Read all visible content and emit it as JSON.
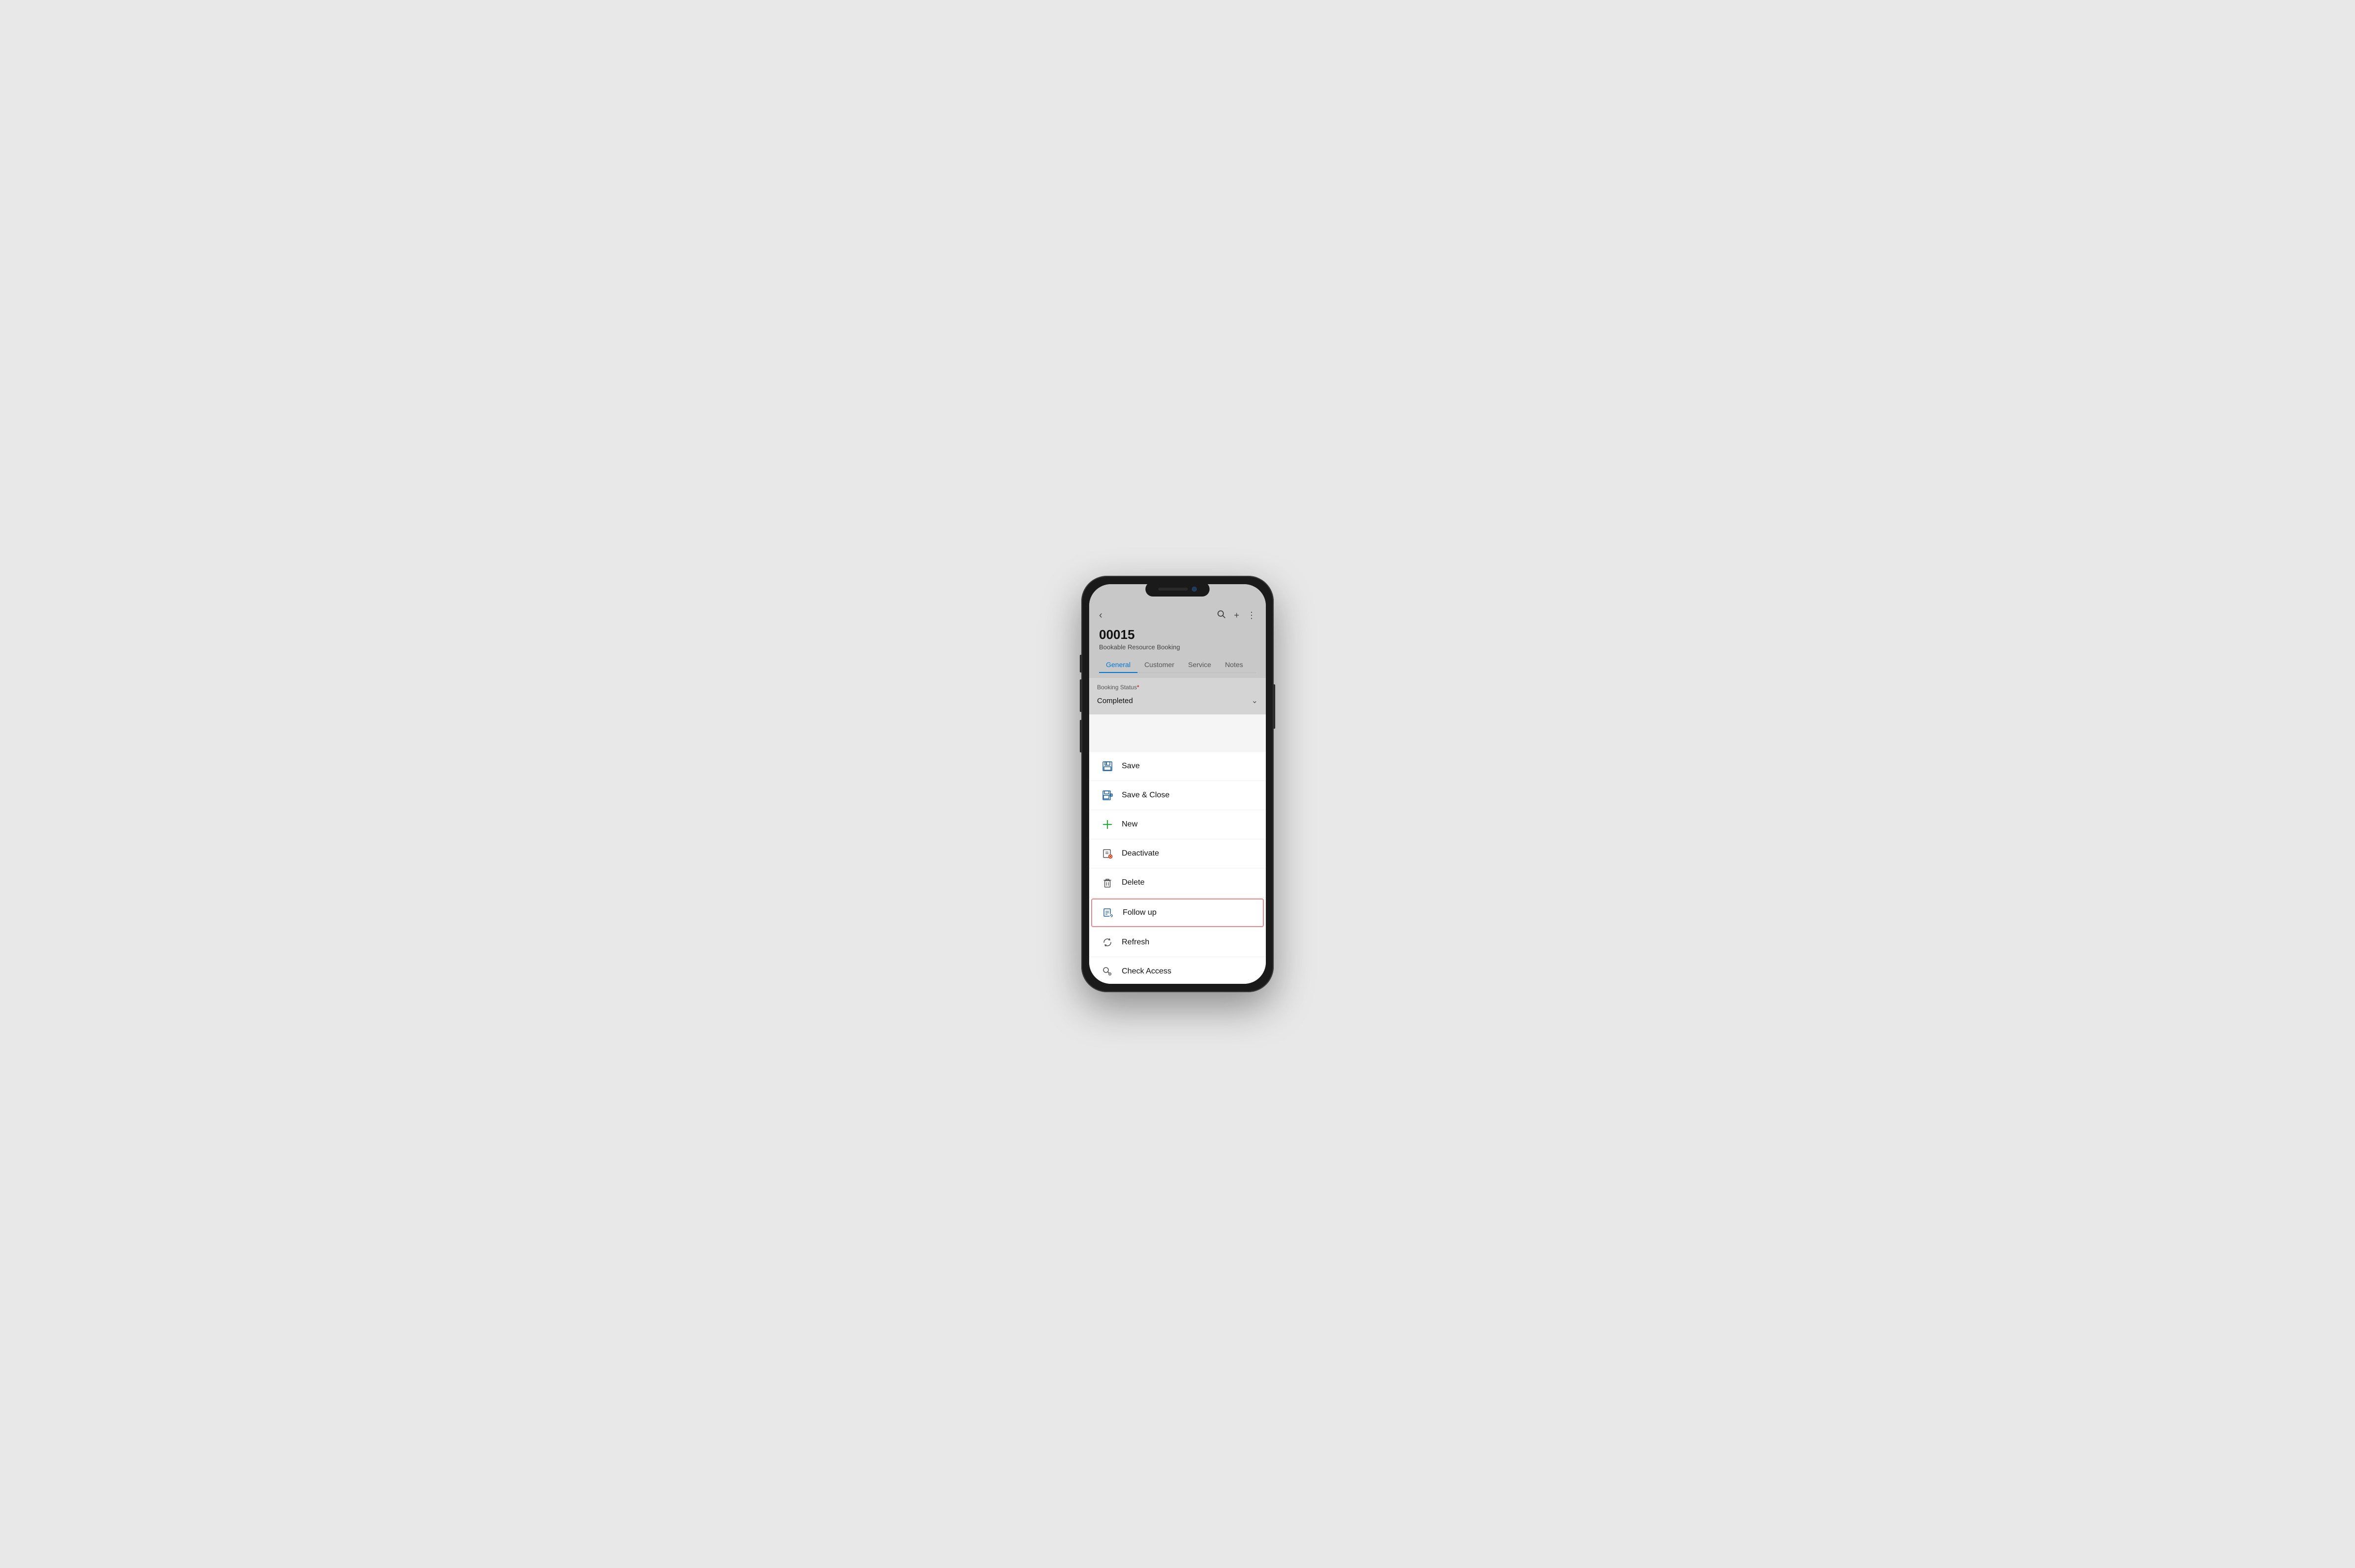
{
  "phone": {
    "header": {
      "record_id": "00015",
      "record_subtitle": "Bookable Resource Booking",
      "back_icon": "‹",
      "search_icon": "⌕",
      "add_icon": "+",
      "more_icon": "⋮"
    },
    "tabs": [
      {
        "id": "general",
        "label": "General",
        "active": true
      },
      {
        "id": "customer",
        "label": "Customer",
        "active": false
      },
      {
        "id": "service",
        "label": "Service",
        "active": false
      },
      {
        "id": "notes",
        "label": "Notes",
        "active": false
      }
    ],
    "form": {
      "booking_status_label": "Booking Status",
      "booking_status_value": "Completed",
      "required": "*"
    },
    "menu": [
      {
        "id": "save",
        "label": "Save",
        "icon": "save"
      },
      {
        "id": "save-close",
        "label": "Save & Close",
        "icon": "save-close"
      },
      {
        "id": "new",
        "label": "New",
        "icon": "new"
      },
      {
        "id": "deactivate",
        "label": "Deactivate",
        "icon": "deactivate"
      },
      {
        "id": "delete",
        "label": "Delete",
        "icon": "delete"
      },
      {
        "id": "follow-up",
        "label": "Follow up",
        "icon": "follow-up",
        "highlighted": true
      },
      {
        "id": "refresh",
        "label": "Refresh",
        "icon": "refresh"
      },
      {
        "id": "check-access",
        "label": "Check Access",
        "icon": "check-access"
      }
    ]
  }
}
